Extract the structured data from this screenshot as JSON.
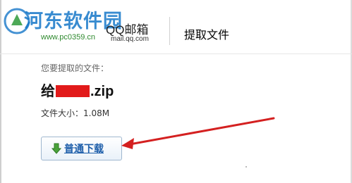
{
  "watermark": {
    "site_name": "河东软件园",
    "url": "www.pc0359.cn"
  },
  "mail_logo": {
    "brand": "QQ邮箱",
    "domain": "mail.qq.com"
  },
  "header": {
    "title": "提取文件"
  },
  "file": {
    "label": "您要提取的文件：",
    "name_prefix": "给",
    "name_suffix": ".zip",
    "size_text": "文件大小：1.08M"
  },
  "download": {
    "label": "普通下载",
    "icon": "down-arrow-icon"
  },
  "colors": {
    "annotation_arrow": "#d42020",
    "link": "#1d5eaa",
    "redaction": "#e21a1a"
  }
}
